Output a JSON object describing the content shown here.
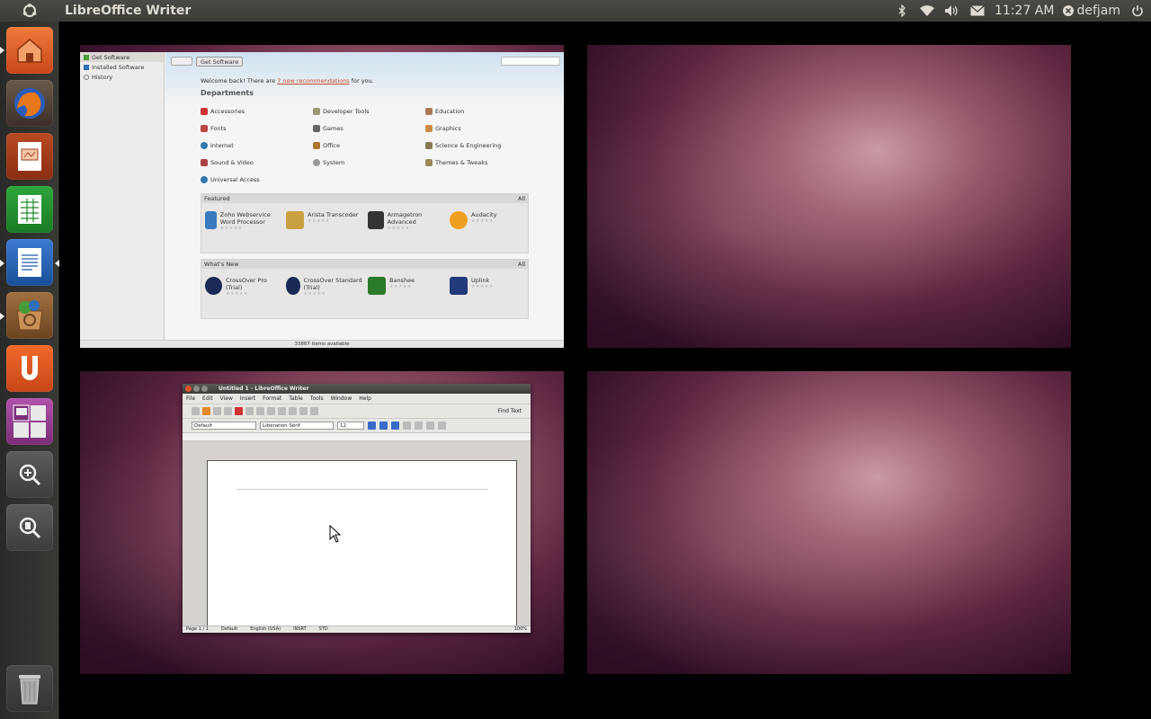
{
  "top_panel": {
    "app_title": "LibreOffice Writer",
    "clock": "11:27 AM",
    "user": "defjam"
  },
  "launcher": {
    "items": [
      {
        "name": "home-folder",
        "color": "#e35b1e"
      },
      {
        "name": "firefox",
        "color": "#2b4d8f"
      },
      {
        "name": "impress",
        "color": "#a63d1a"
      },
      {
        "name": "calc",
        "color": "#1f8a2a"
      },
      {
        "name": "writer",
        "color": "#1e5aa8"
      },
      {
        "name": "software-center",
        "color": "#7a4a1a"
      },
      {
        "name": "ubuntu-one",
        "color": "#dd4814"
      },
      {
        "name": "workspace-switcher",
        "color": "#8a3d87"
      },
      {
        "name": "dash-apps",
        "color": "#555"
      },
      {
        "name": "dash-files",
        "color": "#555"
      }
    ],
    "trash": "trash-icon"
  },
  "software_center": {
    "sidebar": [
      "Get Software",
      "Installed Software",
      "History"
    ],
    "breadcrumb": "Get Software",
    "welcome_pre": "Welcome back! There are ",
    "welcome_link": "7 new recommendations",
    "welcome_post": " for you.",
    "departments_title": "Departments",
    "departments": [
      "Accessories",
      "Developer Tools",
      "Education",
      "Fonts",
      "Games",
      "Graphics",
      "Internet",
      "Office",
      "Science & Engineering",
      "Sound & Video",
      "System",
      "Themes & Tweaks",
      "Universal Access"
    ],
    "featured_title": "Featured",
    "featured_all": "All",
    "featured": [
      "Zoho Webservice Word Processor",
      "Arista Transcoder",
      "Armagetron Advanced",
      "Audacity"
    ],
    "whats_new_title": "What's New",
    "whats_new_all": "All",
    "whats_new": [
      "CrossOver Pro (Trial)",
      "CrossOver Standard (Trial)",
      "Banshee",
      "Uplink"
    ],
    "status": "33867 items available"
  },
  "writer": {
    "title": "Untitled 1 - LibreOffice Writer",
    "menu": [
      "File",
      "Edit",
      "View",
      "Insert",
      "Format",
      "Table",
      "Tools",
      "Window",
      "Help"
    ],
    "find_text": "Find Text",
    "style": "Default",
    "font": "Liberation Serif",
    "size": "12",
    "status": [
      "Page 1 / 1",
      "Default",
      "English (USA)",
      "INSRT",
      "STD",
      "100%"
    ]
  }
}
